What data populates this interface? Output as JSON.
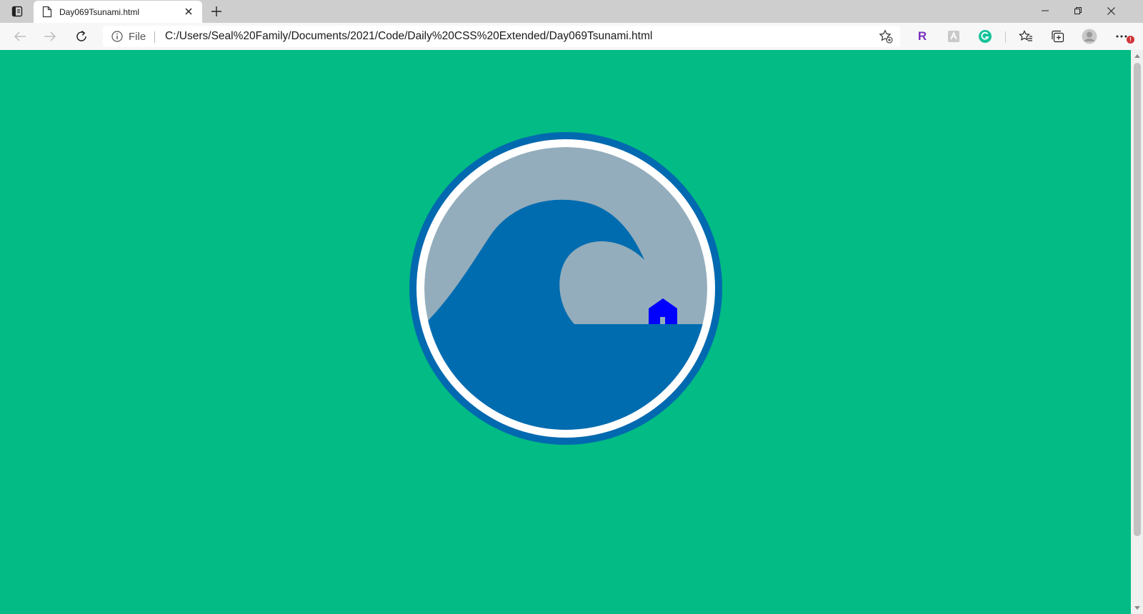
{
  "browser": {
    "tab": {
      "title": "Day069Tsunami.html",
      "icon": "document-icon"
    },
    "address": {
      "scheme_label": "File",
      "url": "C:/Users/Seal%20Family/Documents/2021/Code/Daily%20CSS%20Extended/Day069Tsunami.html"
    },
    "extensions": [
      {
        "name": "R",
        "color": "#7b2fbe"
      },
      {
        "name": "reader-icon"
      },
      {
        "name": "G",
        "color": "#15c39a"
      }
    ],
    "notification_badge": "!",
    "colors": {
      "tabstrip": "#cecece",
      "toolbar": "#f7f7f7"
    }
  },
  "page": {
    "colors": {
      "background": "#02bb85",
      "outer_ring": "#0069af",
      "inner_ring": "#ffffff",
      "sky": "#93adbc",
      "wave": "#006cb0",
      "house": "#0000ff",
      "house_door": "#93adbc"
    }
  }
}
